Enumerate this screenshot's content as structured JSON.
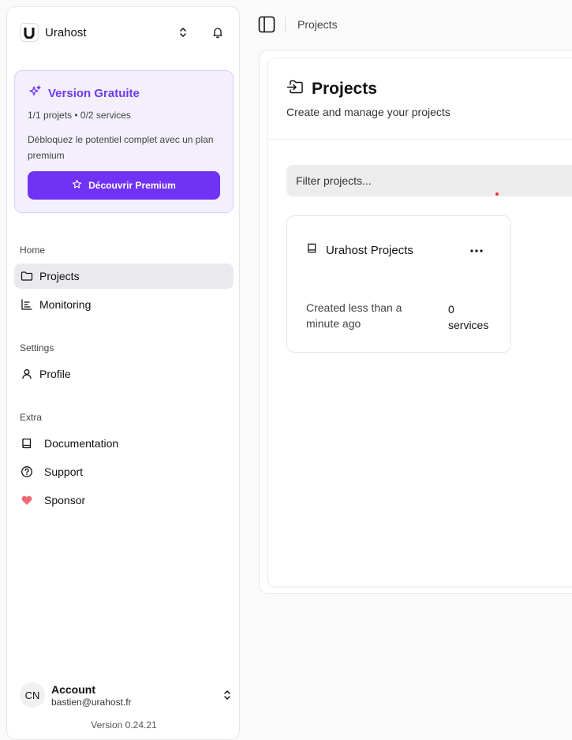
{
  "app": {
    "name": "Urahost",
    "logo_icon": "urahost-logo-icon"
  },
  "promo": {
    "title": "Version Gratuite",
    "usage": "1/1 projets • 0/2 services",
    "description": "Débloquez le potentiel complet avec un plan premium",
    "button_label": "Découvrir Premium",
    "accent_color": "#7033f5"
  },
  "sections": {
    "home": "Home",
    "settings": "Settings",
    "extra": "Extra"
  },
  "nav": {
    "projects": "Projects",
    "monitoring": "Monitoring",
    "profile": "Profile",
    "documentation": "Documentation",
    "support": "Support",
    "sponsor": "Sponsor"
  },
  "account": {
    "initials": "CN",
    "name": "Account",
    "email": "bastien@urahost.fr"
  },
  "version": "Version 0.24.21",
  "breadcrumb": "Projects",
  "page": {
    "title": "Projects",
    "subtitle": "Create and manage your projects",
    "filter_placeholder": "Filter projects..."
  },
  "projects": [
    {
      "name": "Urahost Projects",
      "created": "Created less than a minute ago",
      "services_count": "0",
      "services_label": "services"
    }
  ]
}
